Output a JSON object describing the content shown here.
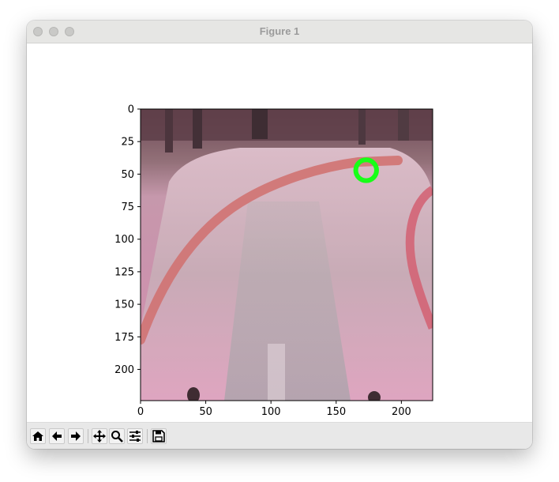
{
  "window": {
    "title": "Figure 1"
  },
  "toolbar": {
    "buttons": [
      {
        "name": "home-button",
        "icon": "home-icon"
      },
      {
        "name": "back-button",
        "icon": "arrow-left-icon"
      },
      {
        "name": "forward-button",
        "icon": "arrow-right-icon"
      },
      {
        "name": "pan-button",
        "icon": "move-icon"
      },
      {
        "name": "zoom-button",
        "icon": "magnifier-icon"
      },
      {
        "name": "configure-subplots-button",
        "icon": "sliders-icon"
      },
      {
        "name": "save-button",
        "icon": "floppy-disk-icon"
      }
    ]
  },
  "chart_data": {
    "type": "image",
    "content": "camera frame of a track with pink overlay",
    "xlim": [
      0,
      224
    ],
    "ylim": [
      224,
      0
    ],
    "xticks": [
      0,
      50,
      100,
      150,
      200
    ],
    "yticks": [
      0,
      25,
      50,
      75,
      100,
      125,
      150,
      175,
      200
    ],
    "xtick_labels": [
      "0",
      "50",
      "100",
      "150",
      "200"
    ],
    "ytick_labels": [
      "0",
      "25",
      "50",
      "75",
      "100",
      "125",
      "150",
      "175",
      "200"
    ],
    "marker": {
      "shape": "circle",
      "x": 173,
      "y": 47,
      "radius": 8,
      "color": "#17ff17"
    },
    "overlay_color": "#d88ab0"
  }
}
